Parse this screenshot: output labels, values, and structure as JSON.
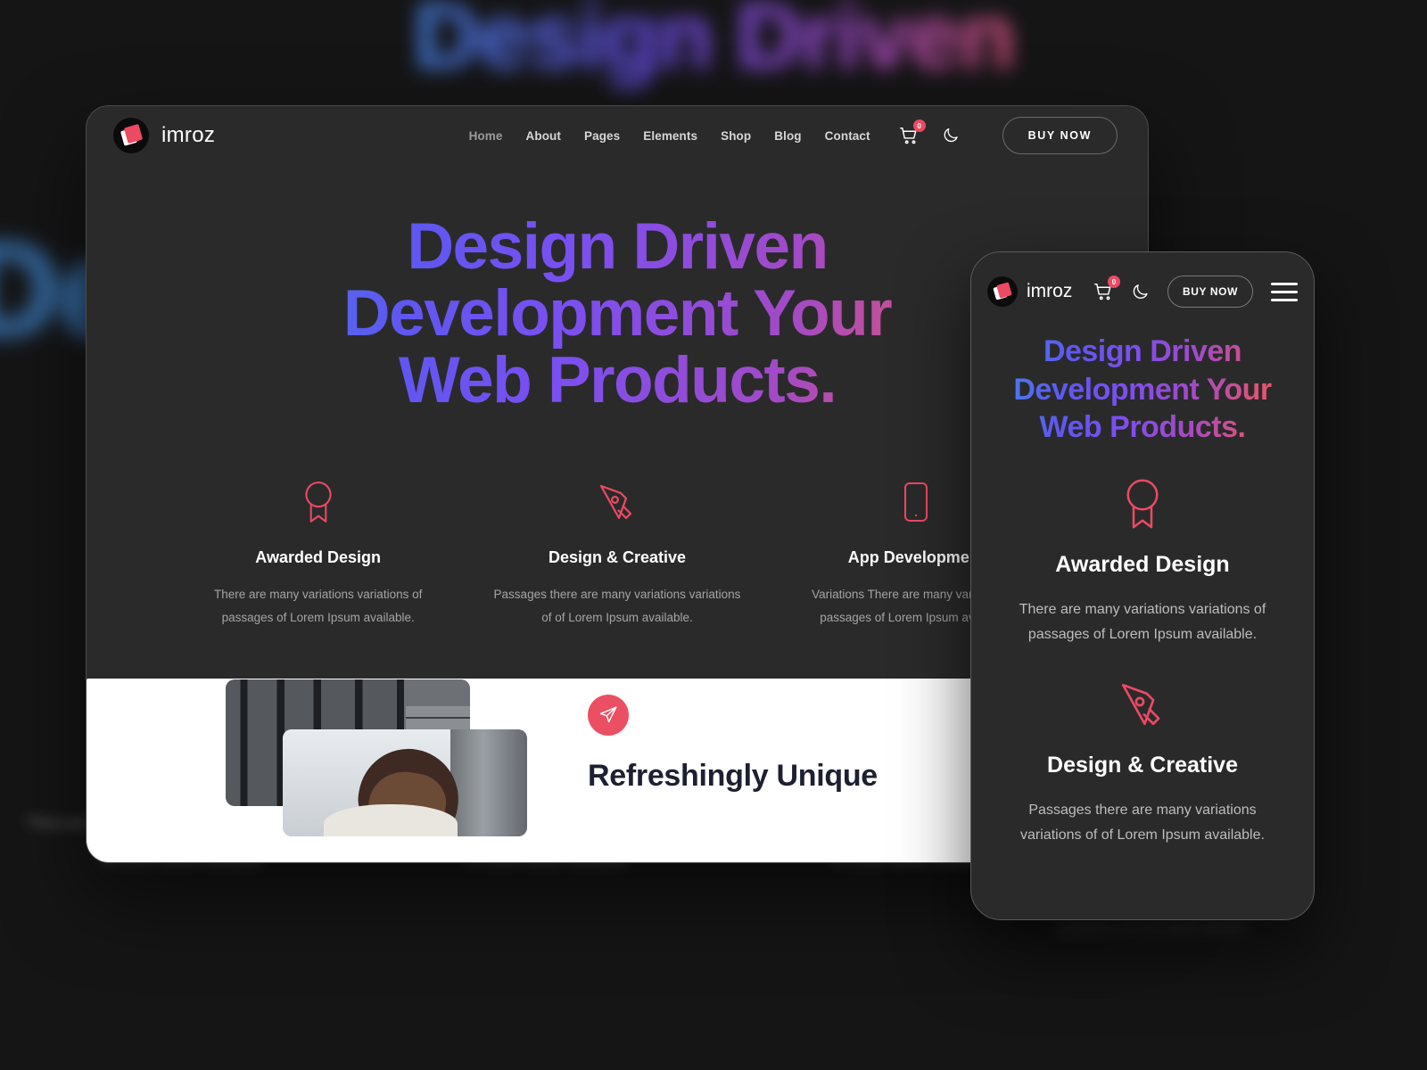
{
  "brand": {
    "name": "imroz",
    "logo_icon": "imroz-logo-icon"
  },
  "desktop": {
    "nav": {
      "links": [
        {
          "label": "Home",
          "active": true
        },
        {
          "label": "About",
          "active": false
        },
        {
          "label": "Pages",
          "active": false
        },
        {
          "label": "Elements",
          "active": false
        },
        {
          "label": "Shop",
          "active": false
        },
        {
          "label": "Blog",
          "active": false
        },
        {
          "label": "Contact",
          "active": false
        }
      ],
      "cart_icon": "shopping-cart-icon",
      "cart_count": "0",
      "dark_mode_icon": "moon-icon",
      "buy_label": "BUY NOW"
    },
    "hero": {
      "line1": "Design Driven",
      "line2": "Development Your",
      "line3": "Web Products."
    },
    "features": [
      {
        "icon": "award-ribbon-icon",
        "title": "Awarded Design",
        "text": "There are many variations variations of passages of Lorem Ipsum available."
      },
      {
        "icon": "pen-nib-icon",
        "title": "Design & Creative",
        "text": "Passages there are many variations variations of of Lorem Ipsum available."
      },
      {
        "icon": "mobile-phone-icon",
        "title": "App Development",
        "text": "Variations There are many variations of passages of Lorem Ipsum available."
      }
    ],
    "white_section": {
      "send_icon": "paper-plane-icon",
      "heading": "Refreshingly Unique"
    }
  },
  "mobile": {
    "nav": {
      "cart_icon": "shopping-cart-icon",
      "cart_count": "0",
      "dark_mode_icon": "moon-icon",
      "buy_label": "BUY NOW",
      "menu_icon": "hamburger-menu-icon"
    },
    "hero": {
      "line1": "Design Driven",
      "line2": "Development Your",
      "line3": "Web Products."
    },
    "features": [
      {
        "icon": "award-ribbon-icon",
        "title": "Awarded Design",
        "text": "There are many variations variations of passages of Lorem Ipsum available."
      },
      {
        "icon": "pen-nib-icon",
        "title": "Design & Creative",
        "text": "Passages there are many variations variations of of Lorem Ipsum available."
      }
    ]
  },
  "background": {
    "blurred_heading": "Design Driven",
    "blurred_left_text": "De",
    "features": [
      {
        "title": "Awarded Design",
        "text": "There are many variations variations of passages of Lorem Ipsum available."
      },
      {
        "title": "Design & Creative",
        "text": "Passages there are many variations variations of of Lorem Ipsum available."
      },
      {
        "title": "App Development",
        "text": "Variations There are many variations of passages of Lorem Ipsum available."
      }
    ],
    "bottom_text": "variations of of Lorem Ipsum"
  },
  "colors": {
    "canvas": "#151516",
    "device": "#2a2a2b",
    "accent_pink": "#ec4a63",
    "gradient_start": "#3f8ae8",
    "gradient_mid": "#7b4ff0",
    "gradient_end": "#ef5350",
    "panel_white": "#ffffff"
  }
}
